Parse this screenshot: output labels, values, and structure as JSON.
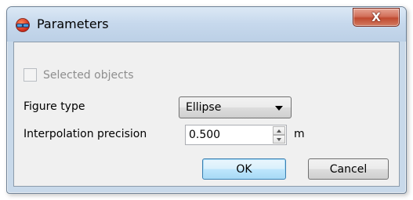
{
  "window": {
    "title": "Parameters",
    "close_label": "X"
  },
  "selected_objects": {
    "label": "Selected objects",
    "checked": false,
    "enabled": false
  },
  "figure_type": {
    "label": "Figure type",
    "value": "Ellipse"
  },
  "interpolation_precision": {
    "label": "Interpolation precision",
    "value": "0.500",
    "unit": "m"
  },
  "buttons": {
    "ok": "OK",
    "cancel": "Cancel"
  },
  "colors": {
    "title_bar": "#c6d8ec",
    "close_button": "#c04a30",
    "default_button_border": "#3c7fb1"
  }
}
